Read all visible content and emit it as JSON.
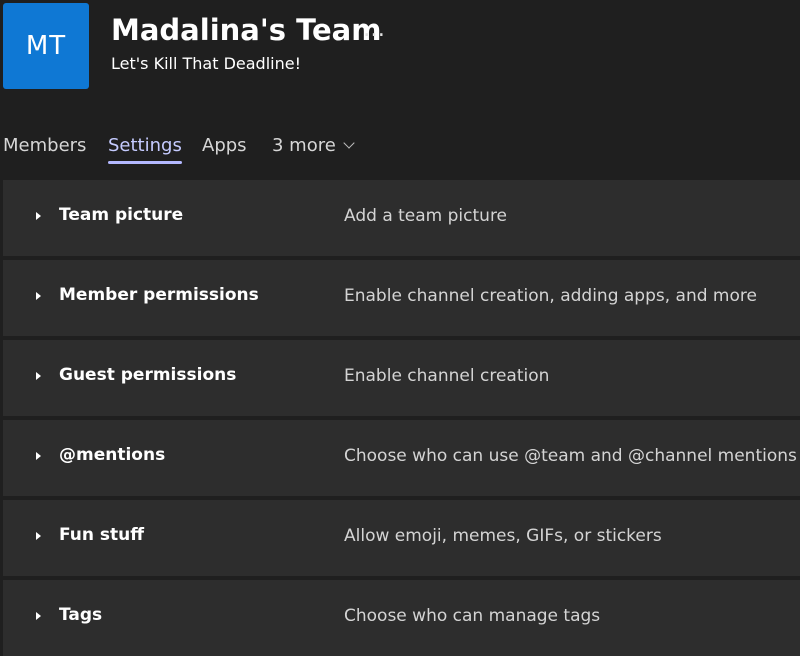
{
  "team": {
    "initials": "MT",
    "name": "Madalina's Team",
    "more_icon": "…",
    "tagline": "Let's Kill That Deadline!"
  },
  "tabs": [
    {
      "label": "Members",
      "active": false
    },
    {
      "label": "Settings",
      "active": true
    },
    {
      "label": "Apps",
      "active": false
    },
    {
      "label": "3 more",
      "active": false
    }
  ],
  "settings": [
    {
      "title": "Team picture",
      "description": "Add a team picture"
    },
    {
      "title": "Member permissions",
      "description": "Enable channel creation, adding apps, and more"
    },
    {
      "title": "Guest permissions",
      "description": "Enable channel creation"
    },
    {
      "title": "@mentions",
      "description": "Choose who can use @team and @channel mentions"
    },
    {
      "title": "Fun stuff",
      "description": "Allow emoji, memes, GIFs, or stickers"
    },
    {
      "title": "Tags",
      "description": "Choose who can manage tags"
    }
  ],
  "colors": {
    "background": "#1f1f1f",
    "row_background": "#2d2d2d",
    "avatar": "#0f78d4",
    "active_tab": "#b3b8ff"
  }
}
